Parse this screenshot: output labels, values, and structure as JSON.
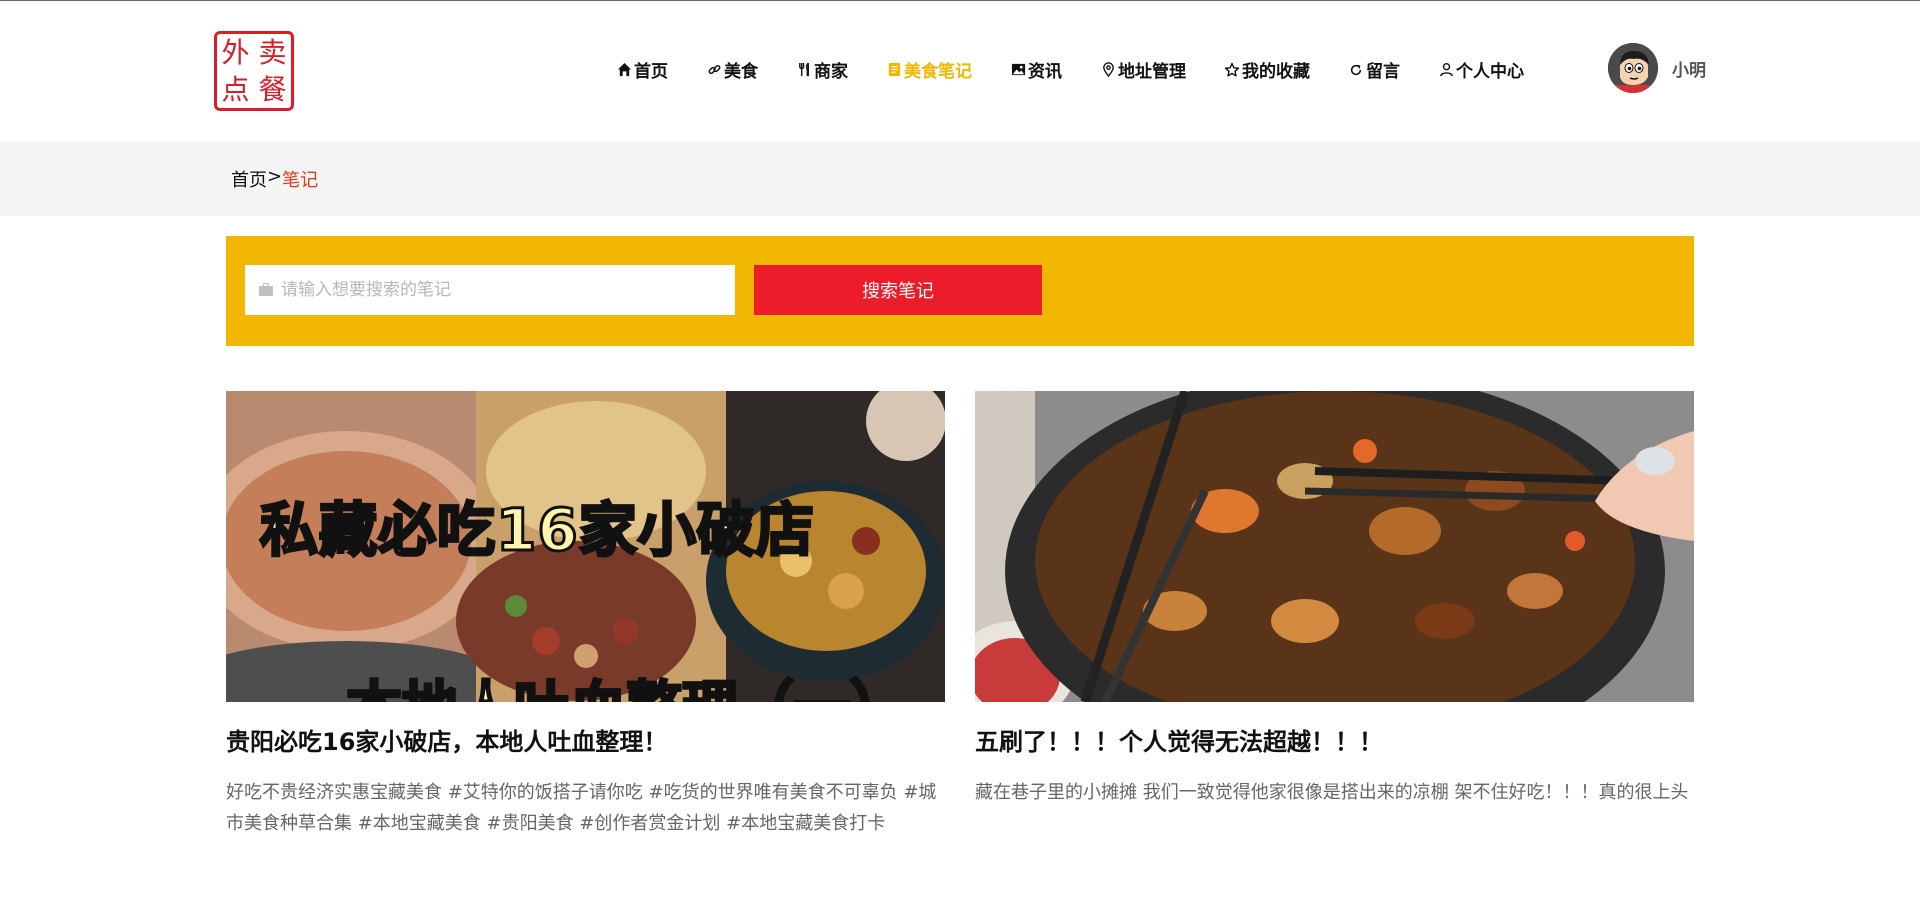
{
  "logo": {
    "chars": [
      "外",
      "卖",
      "点",
      "餐"
    ]
  },
  "nav": {
    "items": [
      {
        "label": "首页",
        "icon": "home-icon"
      },
      {
        "label": "美食",
        "icon": "link-icon"
      },
      {
        "label": "商家",
        "icon": "fork-knife-icon"
      },
      {
        "label": "美食笔记",
        "icon": "notebook-icon",
        "active": true
      },
      {
        "label": "资讯",
        "icon": "image-icon"
      },
      {
        "label": "地址管理",
        "icon": "location-pin-icon"
      },
      {
        "label": "我的收藏",
        "icon": "star-icon"
      },
      {
        "label": "留言",
        "icon": "refresh-icon"
      },
      {
        "label": "个人中心",
        "icon": "user-icon"
      }
    ],
    "active_color": "#f2b703"
  },
  "user": {
    "name": "小明"
  },
  "breadcrumb": {
    "home": "首页",
    "separator": ">",
    "current": "笔记"
  },
  "search": {
    "placeholder": "请输入想要搜索的笔记",
    "button_label": "搜索笔记",
    "panel_color": "#f2b703",
    "button_color": "#ec1c2a"
  },
  "notes": [
    {
      "image_caption_top": "私藏必吃16家小破店",
      "image_caption_bottom": "本地人吐血整理（一）",
      "title": "贵阳必吃16家小破店，本地人吐血整理！",
      "description": "好吃不贵经济实惠宝藏美食 #艾特你的饭搭子请你吃 #吃货的世界唯有美食不可辜负 #城市美食种草合集 #本地宝藏美食 #贵阳美食 #创作者赏金计划 #本地宝藏美食打卡"
    },
    {
      "title": "五刷了！！！个人觉得无法超越！！！",
      "description": "藏在巷子里的小摊摊 我们一致觉得他家很像是搭出来的凉棚 架不住好吃！！！真的很上头"
    }
  ]
}
